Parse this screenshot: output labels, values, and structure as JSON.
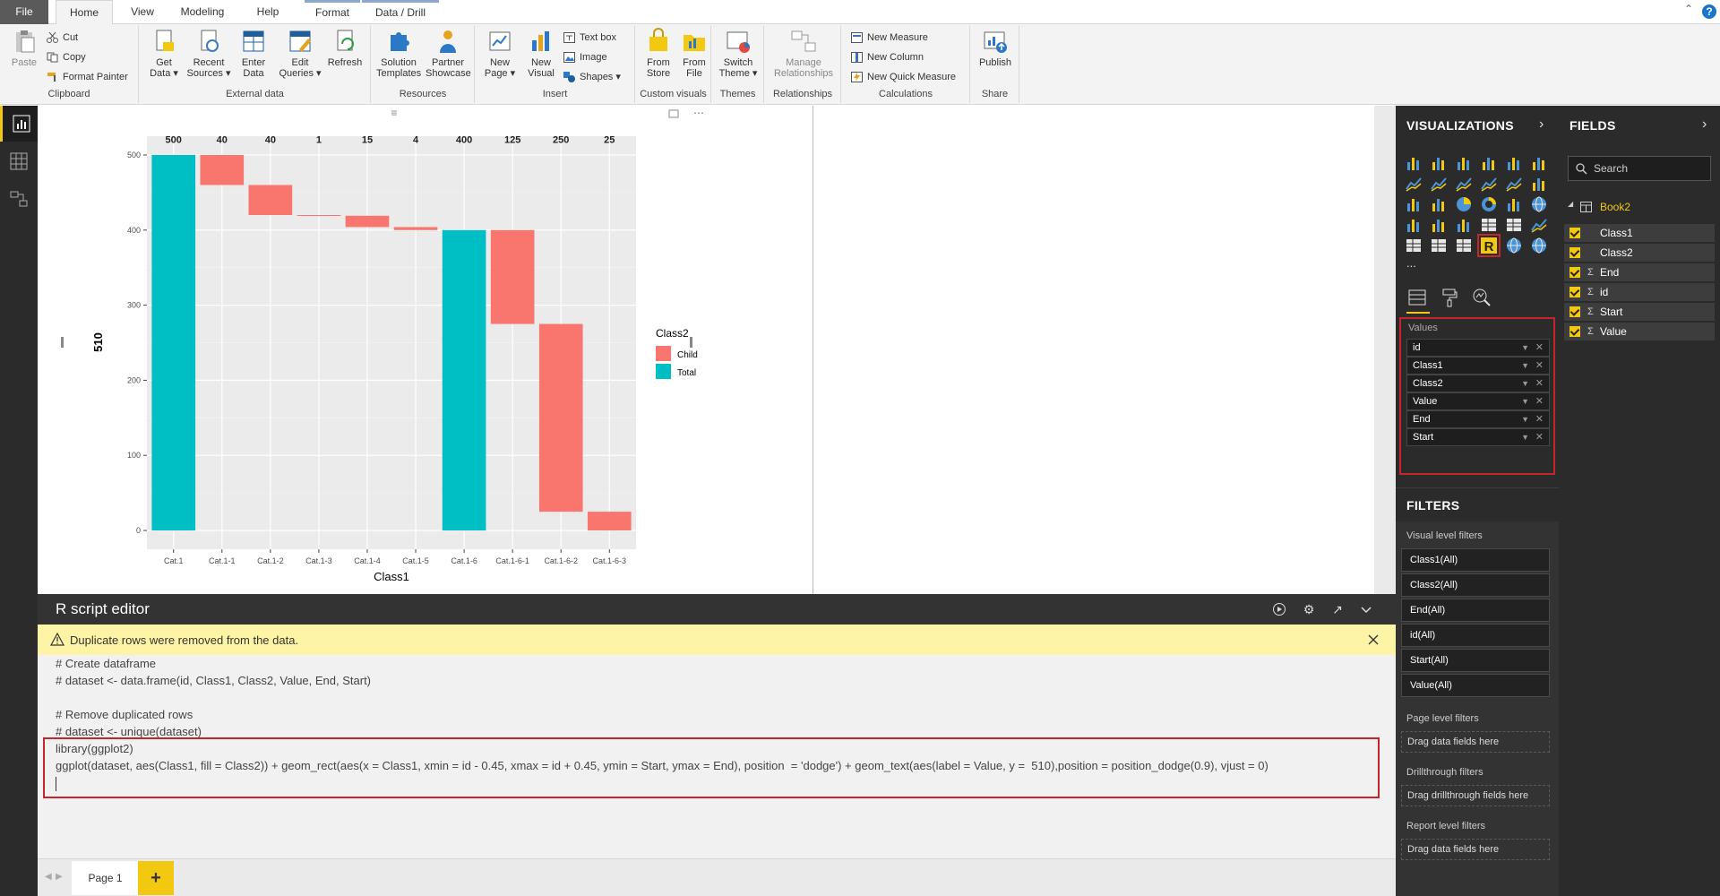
{
  "ribbon": {
    "tabs": [
      "File",
      "Home",
      "View",
      "Modeling",
      "Help",
      "Format",
      "Data / Drill"
    ],
    "clipboard": {
      "paste": "Paste",
      "cut": "Cut",
      "copy": "Copy",
      "format_painter": "Format Painter",
      "label": "Clipboard"
    },
    "external_data": {
      "get_data": [
        "Get",
        "Data ▾"
      ],
      "recent_sources": [
        "Recent",
        "Sources ▾"
      ],
      "enter_data": [
        "Enter",
        "Data"
      ],
      "edit_queries": [
        "Edit",
        "Queries ▾"
      ],
      "refresh": "Refresh",
      "label": "External data"
    },
    "resources": {
      "solution_templates": [
        "Solution",
        "Templates"
      ],
      "partner_showcase": [
        "Partner",
        "Showcase"
      ],
      "label": "Resources"
    },
    "insert": {
      "new_page": [
        "New",
        "Page ▾"
      ],
      "new_visual": [
        "New",
        "Visual"
      ],
      "text_box": "Text box",
      "image": "Image",
      "shapes": "Shapes ▾",
      "label": "Insert"
    },
    "custom_visuals": {
      "from_store": [
        "From",
        "Store"
      ],
      "from_file": [
        "From",
        "File"
      ],
      "label": "Custom visuals"
    },
    "themes": {
      "switch_theme": [
        "Switch",
        "Theme ▾"
      ],
      "label": "Themes"
    },
    "relationships": {
      "manage": [
        "Manage",
        "Relationships"
      ],
      "label": "Relationships"
    },
    "calculations": {
      "new_measure": "New Measure",
      "new_column": "New Column",
      "new_quick_measure": "New Quick Measure",
      "label": "Calculations"
    },
    "share": {
      "publish": "Publish",
      "label": "Share"
    }
  },
  "colors": {
    "child": "#f8766d",
    "total": "#00bfc4",
    "accent": "#f2c811",
    "highlight": "#c4262e"
  },
  "chart_data": {
    "type": "bar",
    "subtype": "waterfall",
    "categories": [
      "Cat.1",
      "Cat.1-1",
      "Cat.1-2",
      "Cat.1-3",
      "Cat.1-4",
      "Cat.1-5",
      "Cat.1-6",
      "Cat.1-6-1",
      "Cat.1-6-2",
      "Cat.1-6-3"
    ],
    "values": [
      500,
      40,
      40,
      1,
      15,
      4,
      400,
      125,
      250,
      25
    ],
    "start": [
      0,
      500,
      460,
      420,
      419,
      404,
      0,
      400,
      275,
      25
    ],
    "end": [
      500,
      460,
      420,
      419,
      404,
      400,
      400,
      275,
      25,
      0
    ],
    "class2": [
      "Total",
      "Child",
      "Child",
      "Child",
      "Child",
      "Child",
      "Total",
      "Child",
      "Child",
      "Child"
    ],
    "value_labels": [
      "500",
      "40",
      "40",
      "1",
      "15",
      "4",
      "400",
      "125",
      "250",
      "25"
    ],
    "xlabel": "Class1",
    "ylabel": "510",
    "ylim": [
      0,
      510
    ],
    "yticks": [
      0,
      100,
      200,
      300,
      400,
      500
    ],
    "grid": true,
    "legend": {
      "title": "Class2",
      "entries": [
        "Child",
        "Total"
      ],
      "placement": "right"
    }
  },
  "r_editor": {
    "title": "R script editor",
    "warning": "Duplicate rows were removed from the data.",
    "code": [
      "# Create dataframe",
      "# dataset <- data.frame(id, Class1, Class2, Value, End, Start)",
      "",
      "# Remove duplicated rows",
      "# dataset <- unique(dataset)",
      "library(ggplot2)",
      "ggplot(dataset, aes(Class1, fill = Class2)) + geom_rect(aes(x = Class1, xmin = id - 0.45, xmax = id + 0.45, ymin = Start, ymax = End), position  = 'dodge') + geom_text(aes(label = Value, y =  510),position = position_dodge(0.9), vjust = 0)"
    ]
  },
  "page_tabs": {
    "page1": "Page 1",
    "add": "+"
  },
  "visualizations": {
    "title": "VISUALIZATIONS",
    "values_label": "Values",
    "wells": [
      "id",
      "Class1",
      "Class2",
      "Value",
      "End",
      "Start"
    ],
    "more": "..."
  },
  "filters": {
    "title": "FILTERS",
    "visual_level": "Visual level filters",
    "cards": [
      "Class1(All)",
      "Class2(All)",
      "End(All)",
      "id(All)",
      "Start(All)",
      "Value(All)"
    ],
    "page_level": "Page level filters",
    "drillthrough": "Drillthrough filters",
    "report_level": "Report level filters",
    "drag_here": "Drag data fields here",
    "drag_drillthrough": "Drag drillthrough fields here"
  },
  "fields": {
    "title": "FIELDS",
    "search_placeholder": "Search",
    "table": "Book2",
    "items": [
      {
        "name": "Class1",
        "sigma": ""
      },
      {
        "name": "Class2",
        "sigma": ""
      },
      {
        "name": "End",
        "sigma": "Σ"
      },
      {
        "name": "id",
        "sigma": "Σ"
      },
      {
        "name": "Start",
        "sigma": "Σ"
      },
      {
        "name": "Value",
        "sigma": "Σ"
      }
    ]
  }
}
